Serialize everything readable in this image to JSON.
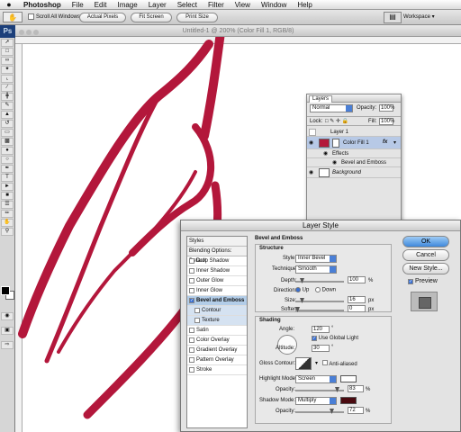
{
  "menubar": {
    "apple": "",
    "app": "Photoshop",
    "items": [
      "File",
      "Edit",
      "Image",
      "Layer",
      "Select",
      "Filter",
      "View",
      "Window",
      "Help"
    ]
  },
  "options": {
    "scroll_all": "Scroll All Windows",
    "actual_pixels": "Actual Pixels",
    "fit_screen": "Fit Screen",
    "print_size": "Print Size",
    "workspace": "Workspace"
  },
  "document": {
    "title": "Untitled-1 @ 200% (Color Fill 1, RGB/8)"
  },
  "toolbox": {
    "logo": "Ps"
  },
  "layers_panel": {
    "tab": "Layers",
    "blend_mode": "Normal",
    "opacity_label": "Opacity:",
    "opacity_value": "100%",
    "lock_label": "Lock:",
    "fill_label": "Fill:",
    "fill_value": "100%",
    "rows": {
      "layer1": "Layer 1",
      "colorfill": "Color Fill 1",
      "fx": "fx",
      "effects": "Effects",
      "bevel": "Bevel and Emboss",
      "background": "Background"
    }
  },
  "dialog": {
    "title": "Layer Style",
    "styles_header": "Styles",
    "blending": "Blending Options: Default",
    "style_items": [
      {
        "label": "Drop Shadow",
        "checked": false
      },
      {
        "label": "Inner Shadow",
        "checked": false
      },
      {
        "label": "Outer Glow",
        "checked": false
      },
      {
        "label": "Inner Glow",
        "checked": false
      },
      {
        "label": "Bevel and Emboss",
        "checked": true
      },
      {
        "label": "Contour",
        "checked": false
      },
      {
        "label": "Texture",
        "checked": false
      },
      {
        "label": "Satin",
        "checked": false
      },
      {
        "label": "Color Overlay",
        "checked": false
      },
      {
        "label": "Gradient Overlay",
        "checked": false
      },
      {
        "label": "Pattern Overlay",
        "checked": false
      },
      {
        "label": "Stroke",
        "checked": false
      }
    ],
    "section_title": "Bevel and Emboss",
    "structure": {
      "title": "Structure",
      "style_label": "Style:",
      "style_value": "Inner Bevel",
      "technique_label": "Technique:",
      "technique_value": "Smooth",
      "depth_label": "Depth:",
      "depth_value": "100",
      "depth_unit": "%",
      "direction_label": "Direction:",
      "dir_up": "Up",
      "dir_down": "Down",
      "size_label": "Size:",
      "size_value": "16",
      "size_unit": "px",
      "soften_label": "Soften:",
      "soften_value": "0",
      "soften_unit": "px"
    },
    "shading": {
      "title": "Shading",
      "angle_label": "Angle:",
      "angle_value": "120",
      "angle_unit": "°",
      "global_light": "Use Global Light",
      "altitude_label": "Altitude:",
      "altitude_value": "30",
      "altitude_unit": "°",
      "gloss_label": "Gloss Contour:",
      "anti_aliased": "Anti-aliased",
      "highlight_label": "Highlight Mode:",
      "highlight_value": "Screen",
      "hl_opacity_label": "Opacity:",
      "hl_opacity_value": "83",
      "hl_opacity_unit": "%",
      "shadow_label": "Shadow Mode:",
      "shadow_value": "Multiply",
      "sh_opacity_label": "Opacity:",
      "sh_opacity_value": "72",
      "sh_opacity_unit": "%"
    },
    "buttons": {
      "ok": "OK",
      "cancel": "Cancel",
      "new_style": "New Style...",
      "preview": "Preview"
    }
  },
  "colors": {
    "vein": "#b3173b",
    "highlight_chip": "#ffffff",
    "shadow_chip": "#4a0a10",
    "accent": "#3e88db"
  }
}
